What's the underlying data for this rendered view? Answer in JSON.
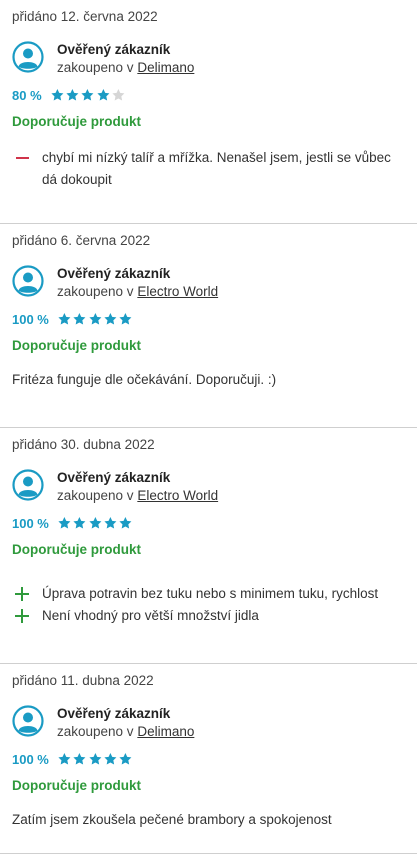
{
  "reviews": [
    {
      "date": "přidáno 12. června 2022",
      "author": "Ověřený zákazník",
      "bought_prefix": "zakoupeno v",
      "shop": "Delimano",
      "rating_pct": "80 %",
      "stars": 4,
      "recommend": "Doporučuje produkt",
      "cons": [
        "chybí mi nízký talíř a mřížka. Nenašel jsem, jestli se vůbec dá dokoupit"
      ]
    },
    {
      "date": "přidáno 6. června 2022",
      "author": "Ověřený zákazník",
      "bought_prefix": "zakoupeno v",
      "shop": "Electro World",
      "rating_pct": "100 %",
      "stars": 5,
      "recommend": "Doporučuje produkt",
      "text": "Fritéza funguje dle očekávání. Doporučuji. :)"
    },
    {
      "date": "přidáno 30. dubna 2022",
      "author": "Ověřený zákazník",
      "bought_prefix": "zakoupeno v",
      "shop": "Electro World",
      "rating_pct": "100 %",
      "stars": 5,
      "recommend": "Doporučuje produkt",
      "pros": [
        "Úprava potravin bez tuku nebo s minimem tuku, rychlost",
        "Není vhodný pro větší množství jidla"
      ]
    },
    {
      "date": "přidáno 11. dubna 2022",
      "author": "Ověřený zákazník",
      "bought_prefix": "zakoupeno v",
      "shop": "Delimano",
      "rating_pct": "100 %",
      "stars": 5,
      "recommend": "Doporučuje produkt",
      "text": "Zatím jsem zkoušela pečené brambory a spokojenost"
    }
  ],
  "colors": {
    "accent_blue": "#1a9bc4",
    "recommend_green": "#2f9a3c",
    "con_red": "#d0344a",
    "star_empty": "#d6d6d6"
  }
}
